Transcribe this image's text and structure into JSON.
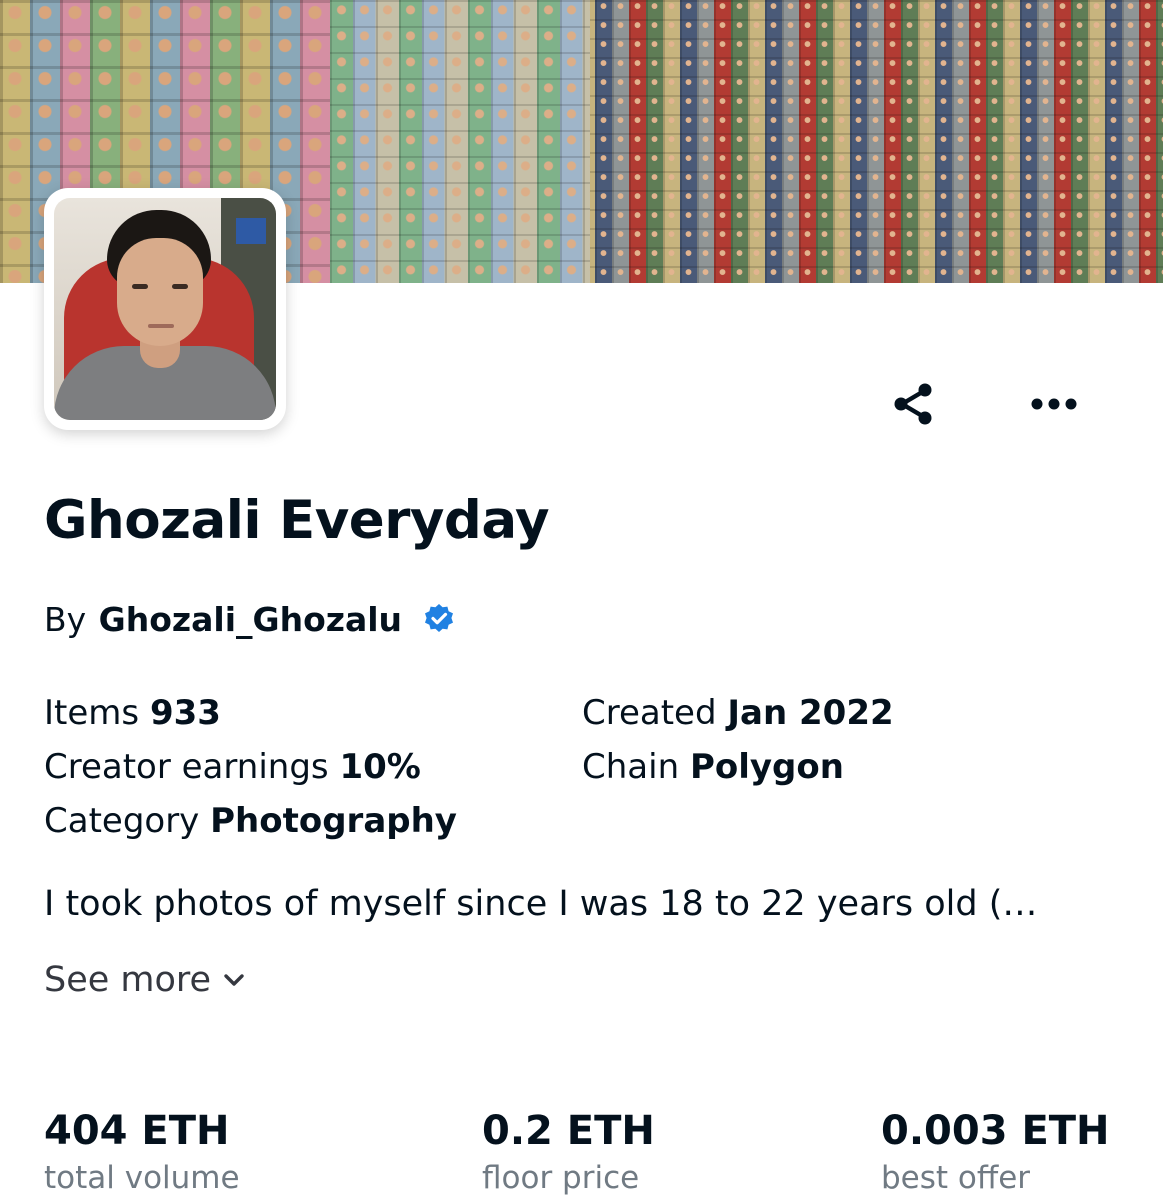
{
  "collection": {
    "title": "Ghozali Everyday",
    "by_prefix": "By",
    "creator": "Ghozali_Ghozalu",
    "verified_icon": "verified-badge-icon",
    "verified_color": "#2081e2",
    "details": {
      "left": [
        {
          "label": "Items",
          "value": "933"
        },
        {
          "label": "Creator earnings",
          "value": "10%"
        },
        {
          "label": "Category",
          "value": "Photography"
        }
      ],
      "right": [
        {
          "label": "Created",
          "value": "Jan 2022"
        },
        {
          "label": "Chain",
          "value": "Polygon"
        }
      ]
    },
    "description": "I took photos of myself since I was 18 to 22 years old (…",
    "see_more": "See more"
  },
  "stats": [
    {
      "value": "404 ETH",
      "label": "total volume"
    },
    {
      "value": "0.2 ETH",
      "label": "floor price"
    },
    {
      "value": "0.003 ETH",
      "label": "best offer"
    }
  ],
  "actions": {
    "share_icon": "share-icon",
    "more_icon": "more-options-icon"
  },
  "colors": {
    "text": "#04111d",
    "muted": "#707a83",
    "accent": "#2081e2"
  }
}
